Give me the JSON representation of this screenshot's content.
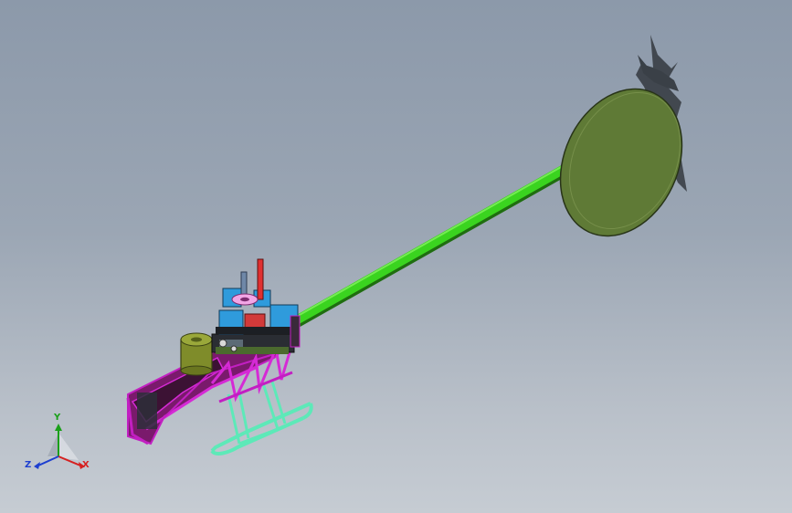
{
  "viewport": {
    "background_top": "#8c99aa",
    "background_bottom": "#c6ccd3"
  },
  "model": {
    "parts": [
      {
        "name": "tail-boom",
        "color": "#3ad41f"
      },
      {
        "name": "tail-disc",
        "color": "#5f7a36"
      },
      {
        "name": "tail-rotor-blur",
        "color": "#3a3f44"
      },
      {
        "name": "frame",
        "color": "#c21fc2"
      },
      {
        "name": "landing-skid",
        "color": "#5de9b8"
      },
      {
        "name": "fuel-tank",
        "color": "#7f8c2a"
      },
      {
        "name": "servo-block",
        "color": "#2f9bdc"
      },
      {
        "name": "rotor-mast",
        "color": "#e03030"
      }
    ]
  },
  "triad": {
    "x_label": "X",
    "y_label": "Y",
    "z_label": "Z",
    "x_color": "#d62020",
    "y_color": "#1aa01a",
    "z_color": "#1d3fd0"
  }
}
